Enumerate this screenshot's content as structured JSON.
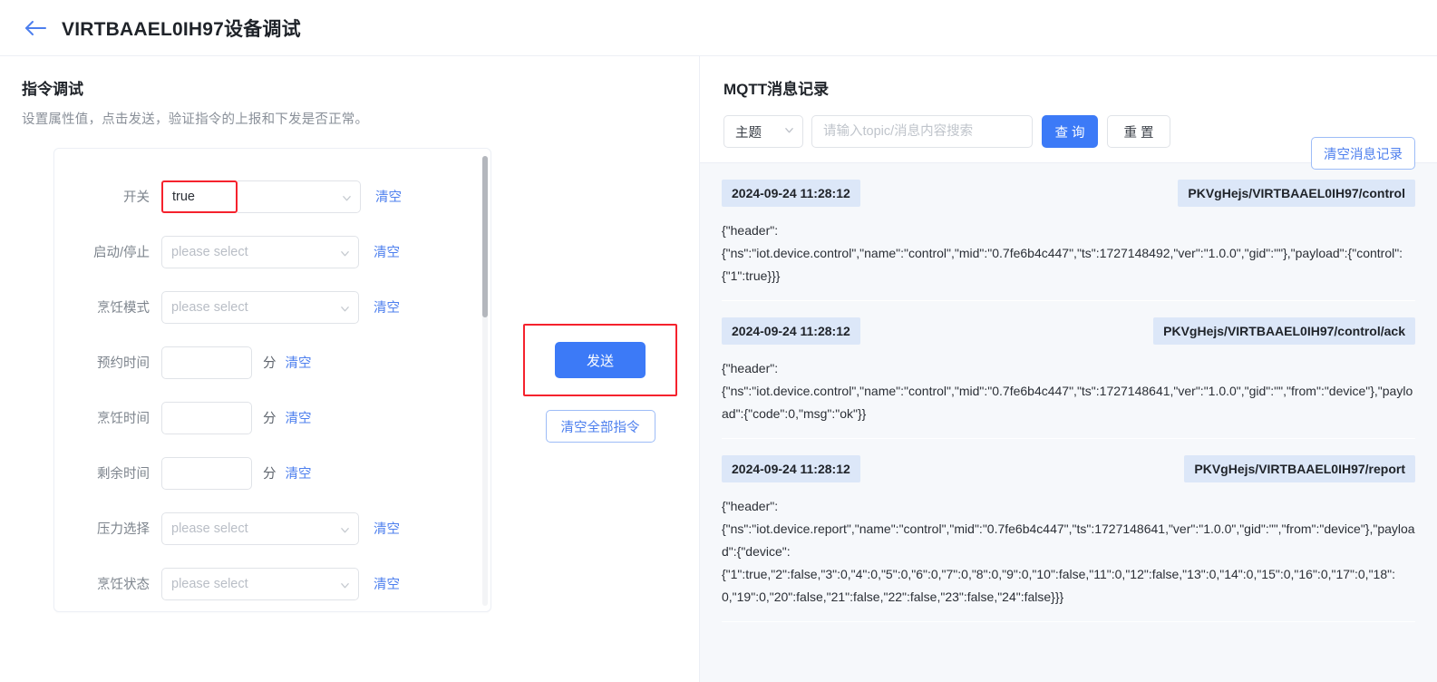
{
  "header": {
    "back_icon": "arrow-left-icon",
    "title": "VIRTBAAEL0IH97设备调试"
  },
  "left": {
    "section_title": "指令调试",
    "section_subtitle": "设置属性值，点击发送，验证指令的上报和下发是否正常。",
    "select_placeholder": "please select",
    "clear_label": "清空",
    "unit_minute": "分",
    "rows": [
      {
        "label": "开关",
        "type": "select",
        "value": "true",
        "highlight": true
      },
      {
        "label": "启动/停止",
        "type": "select",
        "value": "please select",
        "highlight": false
      },
      {
        "label": "烹饪模式",
        "type": "select",
        "value": "please select",
        "highlight": false
      },
      {
        "label": "预约时间",
        "type": "number",
        "value": ""
      },
      {
        "label": "烹饪时间",
        "type": "number",
        "value": ""
      },
      {
        "label": "剩余时间",
        "type": "number",
        "value": ""
      },
      {
        "label": "压力选择",
        "type": "select",
        "value": "please select",
        "highlight": false
      },
      {
        "label": "烹饪状态",
        "type": "select",
        "value": "please select",
        "highlight": false
      }
    ],
    "send_label": "发送",
    "clear_all_label": "清空全部指令"
  },
  "right": {
    "title": "MQTT消息记录",
    "clear_log_label": "清空消息记录",
    "topic_select_value": "主题",
    "search_placeholder": "请输入topic/消息内容搜索",
    "search_value": "",
    "query_label": "查 询",
    "reset_label": "重 置",
    "messages": [
      {
        "time": "2024-09-24 11:28:12",
        "topic": "PKVgHejs/VIRTBAAEL0IH97/control",
        "payload": "{\"header\":\n{\"ns\":\"iot.device.control\",\"name\":\"control\",\"mid\":\"0.7fe6b4c447\",\"ts\":1727148492,\"ver\":\"1.0.0\",\"gid\":\"\"},\"payload\":{\"control\":{\"1\":true}}}"
      },
      {
        "time": "2024-09-24 11:28:12",
        "topic": "PKVgHejs/VIRTBAAEL0IH97/control/ack",
        "payload": "{\"header\":\n{\"ns\":\"iot.device.control\",\"name\":\"control\",\"mid\":\"0.7fe6b4c447\",\"ts\":1727148641,\"ver\":\"1.0.0\",\"gid\":\"\",\"from\":\"device\"},\"payload\":{\"code\":0,\"msg\":\"ok\"}}"
      },
      {
        "time": "2024-09-24 11:28:12",
        "topic": "PKVgHejs/VIRTBAAEL0IH97/report",
        "payload": "{\"header\":\n{\"ns\":\"iot.device.report\",\"name\":\"control\",\"mid\":\"0.7fe6b4c447\",\"ts\":1727148641,\"ver\":\"1.0.0\",\"gid\":\"\",\"from\":\"device\"},\"payload\":{\"device\":\n{\"1\":true,\"2\":false,\"3\":0,\"4\":0,\"5\":0,\"6\":0,\"7\":0,\"8\":0,\"9\":0,\"10\":false,\"11\":0,\"12\":false,\"13\":0,\"14\":0,\"15\":0,\"16\":0,\"17\":0,\"18\":0,\"19\":0,\"20\":false,\"21\":false,\"22\":false,\"23\":false,\"24\":false}}}"
      }
    ]
  },
  "colors": {
    "primary": "#3c7af7",
    "link": "#4d7fee",
    "highlight": "#f5222d",
    "badge_bg": "#dce7f8",
    "list_bg": "#f6f8fb"
  }
}
